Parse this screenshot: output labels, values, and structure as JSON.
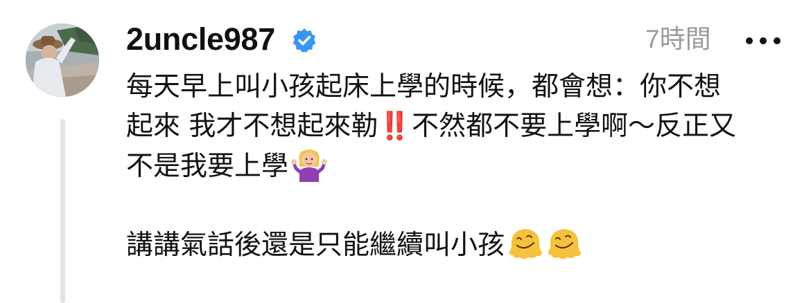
{
  "post": {
    "username": "2uncle987",
    "verified": true,
    "timestamp": "7時間",
    "more_label": "•••",
    "avatar_icon": "user-avatar",
    "badge_icon": "verified-check-icon",
    "accent_color": "#3897f0",
    "lines": [
      "每天早上叫小孩起床上學的時候，都會想：你不想",
      "起來 我才不想起來勒‼️不然都不要上學啊～反正又",
      "不是我要上學",
      "",
      "講講氣話後還是只能繼續叫小孩"
    ],
    "emojis": {
      "line3": "person-shrugging-emoji",
      "line5": [
        "melting-face-emoji",
        "melting-face-emoji"
      ]
    }
  }
}
